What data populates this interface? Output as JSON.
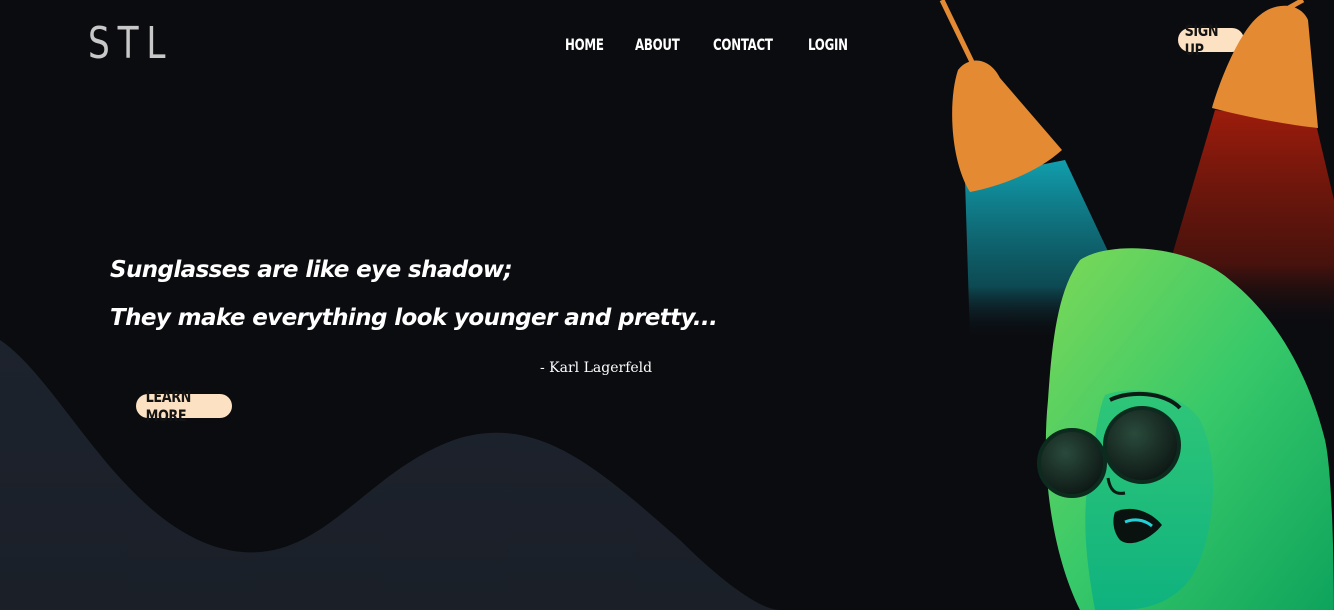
{
  "header": {
    "logo": "STL",
    "nav": [
      "HOME",
      "ABOUT",
      "CONTACT",
      "LOGIN"
    ],
    "signup_label": "SIGN UP"
  },
  "hero": {
    "quote_line1": "Sunglasses are like eye shadow;",
    "quote_line2": "They make everything look younger and pretty...",
    "author": "- Karl Lagerfeld",
    "cta_label": "LEARN MORE"
  },
  "illustration": {
    "name": "woman-with-sunglasses-under-lamps",
    "lamp_color": "#e38a33",
    "left_beam_color": "#12a6b6",
    "right_beam_color": "#a51d0c",
    "face_color": "#17b67e"
  },
  "colors": {
    "background": "#0b0c10",
    "hill": "#1b212b",
    "pill": "#fde1c3",
    "text": "#ffffff"
  }
}
